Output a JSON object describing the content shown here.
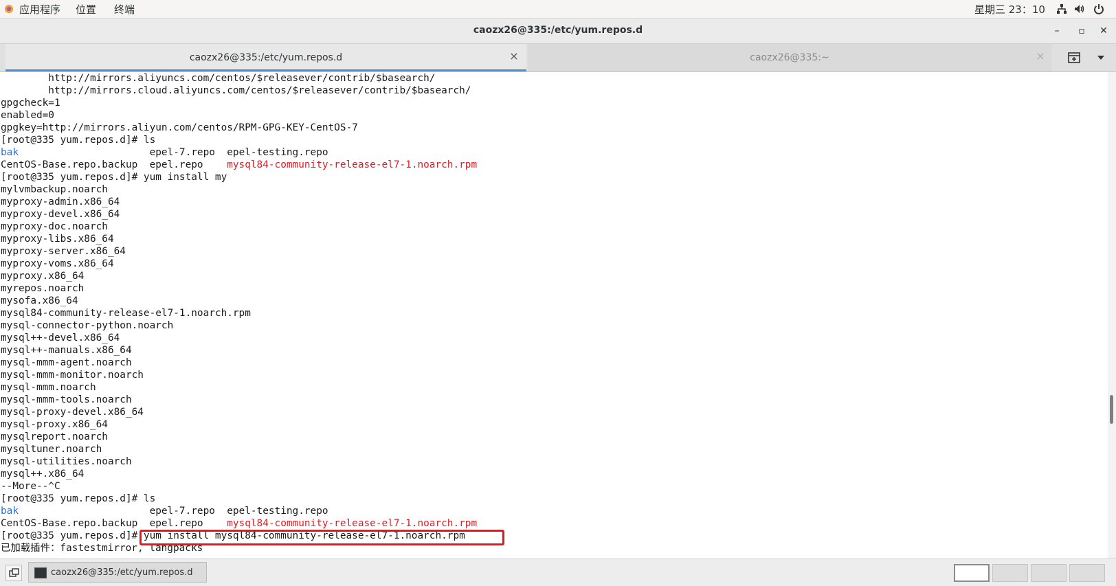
{
  "top_panel": {
    "applications": "应用程序",
    "places": "位置",
    "terminal": "终端",
    "clock": "星期三 23：10"
  },
  "window": {
    "title": "caozx26@335:/etc/yum.repos.d",
    "minimize": "–",
    "maximize": "▫",
    "close": "✕"
  },
  "tabs": [
    {
      "label": "caozx26@335:/etc/yum.repos.d",
      "close": "×",
      "active": true
    },
    {
      "label": "caozx26@335:~",
      "close": "×",
      "active": false
    }
  ],
  "terminal_lines": [
    {
      "text": "        http://mirrors.aliyuncs.com/centos/$releasever/contrib/$basearch/"
    },
    {
      "text": "        http://mirrors.cloud.aliyuncs.com/centos/$releasever/contrib/$basearch/"
    },
    {
      "text": "gpgcheck=1"
    },
    {
      "text": "enabled=0"
    },
    {
      "text": "gpgkey=http://mirrors.aliyun.com/centos/RPM-GPG-KEY-CentOS-7"
    },
    {
      "text": "[root@335 yum.repos.d]# ls"
    },
    {
      "parts": [
        {
          "text": "bak",
          "color": "blue"
        },
        {
          "text": "                      epel-7.repo  epel-testing.repo"
        }
      ]
    },
    {
      "parts": [
        {
          "text": "CentOS-Base.repo.backup  epel.repo    "
        },
        {
          "text": "mysql84-community-release-el7-1.noarch.rpm",
          "color": "red"
        }
      ]
    },
    {
      "text": "[root@335 yum.repos.d]# yum install my"
    },
    {
      "text": "mylvmbackup.noarch"
    },
    {
      "text": "myproxy-admin.x86_64"
    },
    {
      "text": "myproxy-devel.x86_64"
    },
    {
      "text": "myproxy-doc.noarch"
    },
    {
      "text": "myproxy-libs.x86_64"
    },
    {
      "text": "myproxy-server.x86_64"
    },
    {
      "text": "myproxy-voms.x86_64"
    },
    {
      "text": "myproxy.x86_64"
    },
    {
      "text": "myrepos.noarch"
    },
    {
      "text": "mysofa.x86_64"
    },
    {
      "text": "mysql84-community-release-el7-1.noarch.rpm"
    },
    {
      "text": "mysql-connector-python.noarch"
    },
    {
      "text": "mysql++-devel.x86_64"
    },
    {
      "text": "mysql++-manuals.x86_64"
    },
    {
      "text": "mysql-mmm-agent.noarch"
    },
    {
      "text": "mysql-mmm-monitor.noarch"
    },
    {
      "text": "mysql-mmm.noarch"
    },
    {
      "text": "mysql-mmm-tools.noarch"
    },
    {
      "text": "mysql-proxy-devel.x86_64"
    },
    {
      "text": "mysql-proxy.x86_64"
    },
    {
      "text": "mysqlreport.noarch"
    },
    {
      "text": "mysqltuner.noarch"
    },
    {
      "text": "mysql-utilities.noarch"
    },
    {
      "text": "mysql++.x86_64"
    },
    {
      "text": "--More--^C"
    },
    {
      "text": "[root@335 yum.repos.d]# ls"
    },
    {
      "parts": [
        {
          "text": "bak",
          "color": "blue"
        },
        {
          "text": "                      epel-7.repo  epel-testing.repo"
        }
      ]
    },
    {
      "parts": [
        {
          "text": "CentOS-Base.repo.backup  epel.repo    "
        },
        {
          "text": "mysql84-community-release-el7-1.noarch.rpm",
          "color": "red"
        }
      ]
    },
    {
      "text": "[root@335 yum.repos.d]# yum install mysql84-community-release-el7-1.noarch.rpm"
    },
    {
      "text": "已加载插件：fastestmirror, langpacks"
    }
  ],
  "taskbar": {
    "window_item": "caozx26@335:/etc/yum.repos.d"
  },
  "colors": {
    "accent_blue": "#4a90d9",
    "terminal_blue": "#2a6fd6",
    "terminal_red": "#e01b24",
    "highlight_red": "#e8151b"
  },
  "icons": {
    "apps": "applications-icon",
    "network": "network-icon",
    "volume": "volume-icon",
    "power": "power-icon",
    "new_tab": "new-tab-icon",
    "tab_menu": "chevron-down-icon"
  }
}
